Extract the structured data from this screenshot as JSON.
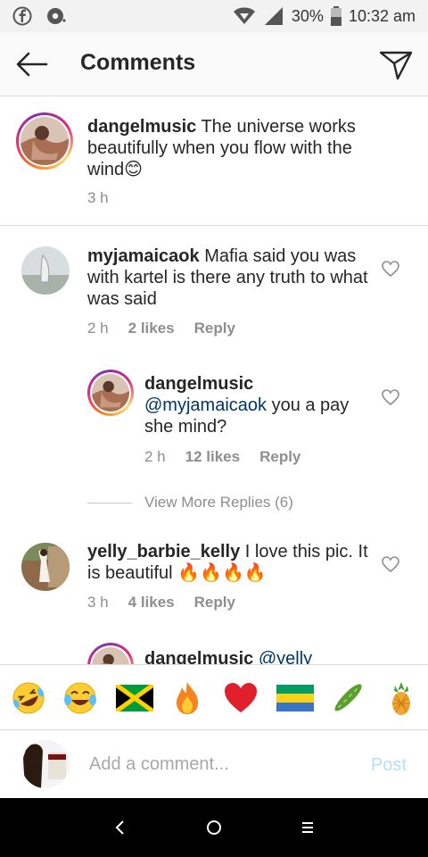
{
  "status_bar": {
    "battery": "30%",
    "time": "10:32 am"
  },
  "header": {
    "title": "Comments"
  },
  "caption": {
    "username": "dangelmusic",
    "text": " The universe works beautifully when you flow with the wind",
    "emoji": "😊",
    "time": "3 h"
  },
  "comments": [
    {
      "username": "myjamaicaok",
      "text": " Mafia said you was with kartel is there any truth to what was said",
      "time": "2 h",
      "likes": "2 likes",
      "reply": "Reply"
    },
    {
      "username": "dangelmusic",
      "mention": "@myjamaicaok",
      "text": " you a pay she mind?",
      "time": "2 h",
      "likes": "12 likes",
      "reply": "Reply"
    },
    {
      "username": "yelly_barbie_kelly",
      "text": " I love this pic. It is beautiful ",
      "emoji": "🔥🔥🔥🔥",
      "time": "3 h",
      "likes": "4 likes",
      "reply": "Reply"
    },
    {
      "username": "dangelmusic",
      "mention": "@yelly"
    }
  ],
  "view_more": "View More Replies (6)",
  "emoji_bar": [
    "🤣",
    "😂",
    "jamaica-flag",
    "🔥",
    "❤️",
    "gabon-flag",
    "🥒",
    "🍍"
  ],
  "input": {
    "placeholder": "Add a comment...",
    "post_label": "Post"
  },
  "colors": {
    "mention": "#003569",
    "post_disabled": "#b2dffc",
    "meta_gray": "#8e8e8e"
  }
}
